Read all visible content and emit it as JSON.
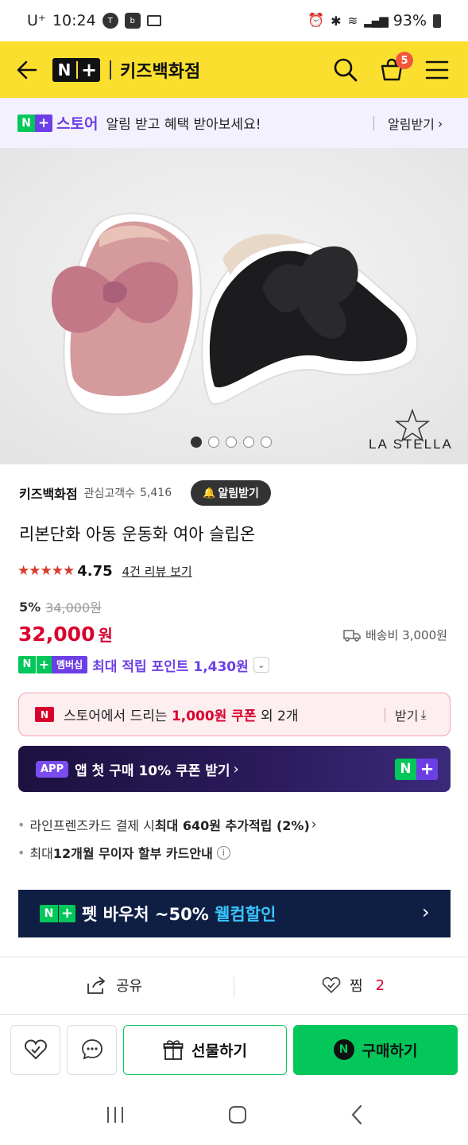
{
  "status_bar": {
    "carrier": "U⁺",
    "time": "10:24",
    "battery": "93%"
  },
  "header": {
    "badge_n": "N",
    "badge_plus": "+",
    "title": "키즈백화점",
    "cart_count": "5"
  },
  "banner": {
    "store_n": "N",
    "store_plus": "+",
    "store_label": "스토어",
    "text": "알림 받고 혜택 받아보세요!",
    "action": "알림받기"
  },
  "hero": {
    "brand": "LA STELLA",
    "dots": 5,
    "active_dot": 0
  },
  "shop": {
    "name": "키즈백화점",
    "followers_label": "관심고객수",
    "followers": "5,416",
    "alert_btn": "알림받기"
  },
  "product": {
    "title": "리본단화 아동 운동화 여아 슬립온",
    "stars": "★★★★★",
    "rating": "4.75",
    "review_link": "4건 리뷰 보기",
    "discount": "5%",
    "original_price": "34,000원",
    "price_num": "32,000",
    "price_unit": "원",
    "shipping": "배송비 3,000원"
  },
  "membership": {
    "badge_n": "N",
    "badge_plus": "+",
    "badge_text": "멤버십",
    "text": "최대 적립 포인트 1,430원"
  },
  "coupon": {
    "icon": "N",
    "text_pre": "스토어에서 드리는 ",
    "text_bold": "1,000원 쿠폰",
    "text_post": " 외 2개",
    "action": "받기"
  },
  "app_banner": {
    "tag": "APP",
    "text": "앱 첫 구매 10% 쿠폰 받기",
    "badge_n": "N",
    "badge_plus": "+"
  },
  "benefits": [
    {
      "pre": "라인프렌즈카드 결제 시 ",
      "bold": "최대 640원 추가적립 (2%)"
    },
    {
      "pre": "최대 ",
      "bold": "12개월 무이자 할부 카드안내"
    }
  ],
  "voucher": {
    "badge_n": "N",
    "badge_plus": "+",
    "text_white": "펫 바우처 ~50% ",
    "text_accent": "웰컴할인"
  },
  "share_row": {
    "share": "공유",
    "zzim": "찜",
    "zzim_count": "2"
  },
  "bottom": {
    "gift": "선물하기",
    "buy": "구매하기",
    "buy_icon": "N"
  },
  "colors": {
    "header_yellow": "#fbdf2e",
    "naver_green": "#03c75a",
    "price_red": "#d9002e",
    "membership_purple": "#6c3fe6",
    "voucher_navy": "#0f1f44",
    "app_banner": "#1c1140"
  }
}
